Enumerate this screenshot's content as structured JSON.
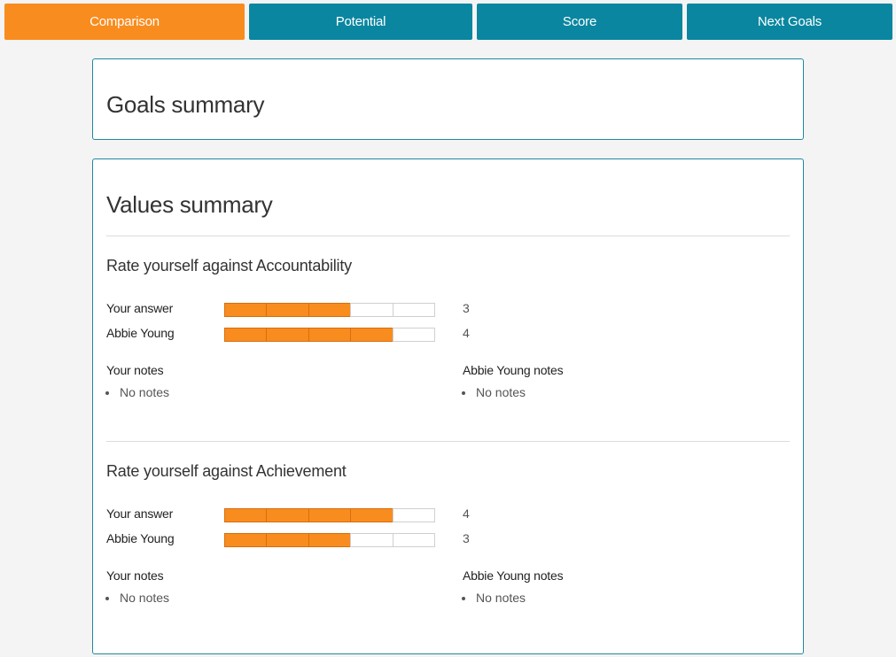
{
  "tabs": [
    {
      "label": "Comparison",
      "active": true
    },
    {
      "label": "Potential",
      "active": false
    },
    {
      "label": "Score",
      "active": false
    },
    {
      "label": "Next Goals",
      "active": false
    }
  ],
  "colors": {
    "active_tab": "#f98c1e",
    "inactive_tab": "#0a86a0",
    "panel_border": "#1e88a0",
    "bar_fill": "#f98c1e"
  },
  "goals_panel": {
    "title": "Goals summary"
  },
  "values_panel": {
    "title": "Values summary",
    "sections": [
      {
        "heading": "Rate yourself against Accountability",
        "ratings": [
          {
            "label": "Your answer",
            "value": "3",
            "score": 3,
            "max": 5
          },
          {
            "label": "Abbie Young",
            "value": "4",
            "score": 4,
            "max": 5
          }
        ],
        "notes": [
          {
            "title": "Your notes",
            "items": [
              "No notes"
            ]
          },
          {
            "title": "Abbie Young notes",
            "items": [
              "No notes"
            ]
          }
        ]
      },
      {
        "heading": "Rate yourself against Achievement",
        "ratings": [
          {
            "label": "Your answer",
            "value": "4",
            "score": 4,
            "max": 5
          },
          {
            "label": "Abbie Young",
            "value": "3",
            "score": 3,
            "max": 5
          }
        ],
        "notes": [
          {
            "title": "Your notes",
            "items": [
              "No notes"
            ]
          },
          {
            "title": "Abbie Young notes",
            "items": [
              "No notes"
            ]
          }
        ]
      }
    ]
  }
}
